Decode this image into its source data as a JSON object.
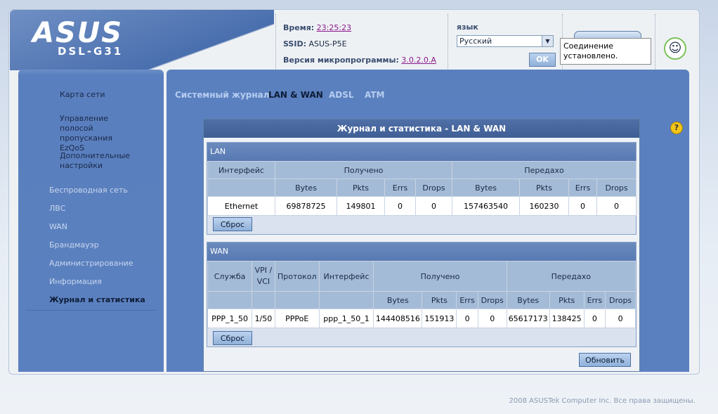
{
  "header": {
    "brand": "ASUS",
    "model": "DSL-G31",
    "time_label": "Время:",
    "time_value": "23:25:23",
    "ssid_label": "SSID:",
    "ssid_value": "ASUS-P5E",
    "fw_label": "Версия микропрограммы:",
    "fw_value": "3.0.2.0.A",
    "lang_label": "язык",
    "lang_value": "Русский",
    "ok_label": "OK",
    "tooltip": "Соединение установлено."
  },
  "sidebar": {
    "sub_items": [
      "Карта сети",
      "Управление полосой пропускания EzQoS",
      "Дополнительные настройки"
    ],
    "main_items": [
      {
        "label": "Беспроводная сеть",
        "active": false
      },
      {
        "label": "ЛВС",
        "active": false
      },
      {
        "label": "WAN",
        "active": false
      },
      {
        "label": "Брандмауэр",
        "active": false
      },
      {
        "label": "Администрирование",
        "active": false
      },
      {
        "label": "Информация",
        "active": false
      },
      {
        "label": "Журнал и статистика",
        "active": true
      }
    ]
  },
  "tabs": [
    {
      "label": "Системный журнал",
      "active": false
    },
    {
      "label": "LAN & WAN",
      "active": true
    },
    {
      "label": "ADSL",
      "active": false
    },
    {
      "label": "ATM",
      "active": false
    }
  ],
  "panel": {
    "title": "Журнал и статистика - LAN & WAN",
    "refresh_label": "Обновить"
  },
  "lan": {
    "title": "LAN",
    "h_interface": "Интерфейс",
    "h_received": "Получено",
    "h_sent": "Передаxо",
    "subheaders": [
      "Bytes",
      "Pkts",
      "Errs",
      "Drops",
      "Bytes",
      "Pkts",
      "Errs",
      "Drops"
    ],
    "row": [
      "Ethernet",
      "69878725",
      "149801",
      "0",
      "0",
      "157463540",
      "160230",
      "0",
      "0"
    ],
    "reset_label": "Сброс"
  },
  "wan": {
    "title": "WAN",
    "h_service": "Служба",
    "h_vpivci": "VPI / VCI",
    "h_protocol": "Протокол",
    "h_interface": "Интерфейс",
    "h_received": "Получено",
    "h_sent": "Передаxо",
    "subheaders": [
      "Bytes",
      "Pkts",
      "Errs",
      "Drops",
      "Bytes",
      "Pkts",
      "Errs",
      "Drops"
    ],
    "row": [
      "PPP_1_50",
      "1/50",
      "PPPoE",
      "ppp_1_50_1",
      "144408516",
      "151913",
      "0",
      "0",
      "65617173",
      "138425",
      "0",
      "0"
    ],
    "reset_label": "Сброс"
  },
  "footer": "2008 ASUSTek Computer Inc. Все права защищены."
}
